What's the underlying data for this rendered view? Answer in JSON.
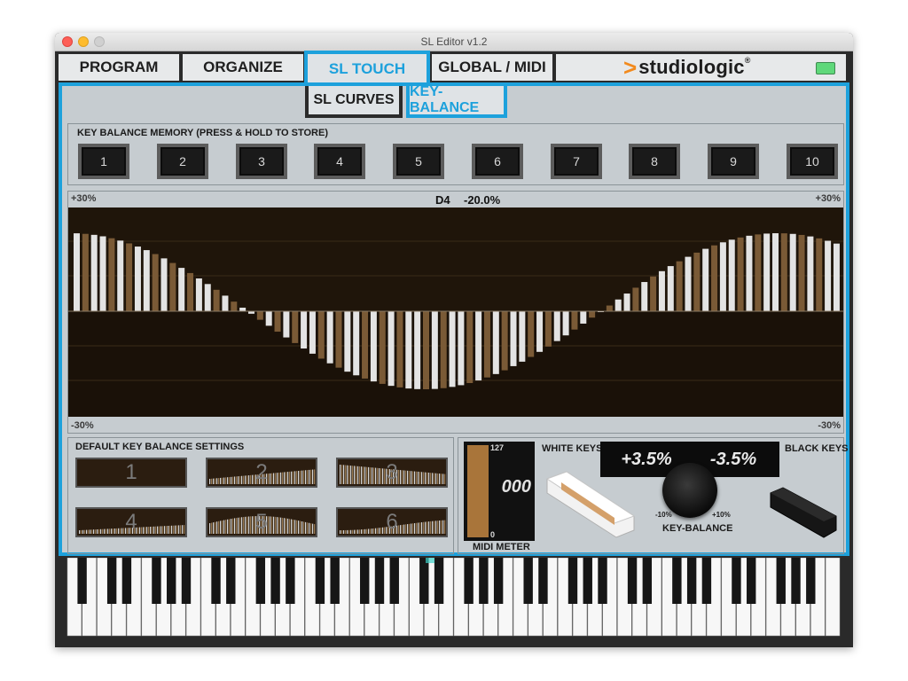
{
  "window": {
    "title": "SL Editor v1.2"
  },
  "tabs": [
    "PROGRAM",
    "ORGANIZE",
    "SL TOUCH",
    "GLOBAL / MIDI"
  ],
  "active_tab": "SL TOUCH",
  "brand": {
    "arrow": ">",
    "name": "studiologic",
    "reg": "®",
    "accent": "#f28a1d"
  },
  "subtabs": [
    "SL CURVES",
    "KEY-BALANCE"
  ],
  "active_subtab": "KEY-BALANCE",
  "memory": {
    "title": "KEY BALANCE MEMORY (PRESS & HOLD TO STORE)",
    "buttons": [
      "1",
      "2",
      "3",
      "4",
      "5",
      "6",
      "7",
      "8",
      "9",
      "10"
    ]
  },
  "graph": {
    "top_left": "+30%",
    "top_right": "+30%",
    "bottom_left": "-30%",
    "bottom_right": "-30%",
    "note": "D4",
    "value": "-20.0%"
  },
  "defaults": {
    "title": "DEFAULT KEY BALANCE SETTINGS",
    "presets": [
      "1",
      "2",
      "3",
      "4",
      "5",
      "6"
    ]
  },
  "midi_meter": {
    "label": "MIDI METER",
    "max": "127",
    "min": "0",
    "value": "000"
  },
  "key_balance": {
    "white_label": "WHITE KEYS",
    "black_label": "BLACK KEYS",
    "white_value": "+3.5%",
    "black_value": "-3.5%",
    "knob_label": "KEY-BALANCE",
    "min": "-10%",
    "max": "+10%"
  },
  "colors": {
    "accent": "#1da1dc",
    "led": "#5fd87a"
  }
}
